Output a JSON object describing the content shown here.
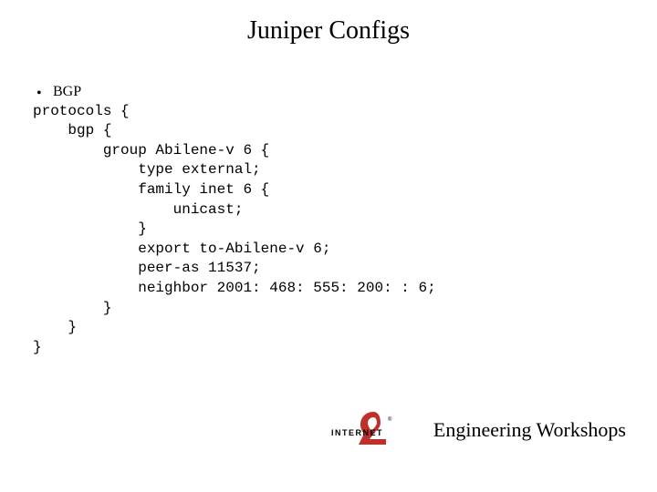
{
  "title": "Juniper Configs",
  "bullet": "BGP",
  "code": "protocols {\n    bgp {\n        group Abilene-v 6 {\n            type external;\n            family inet 6 {\n                unicast;\n            }\n            export to-Abilene-v 6;\n            peer-as 11537;\n            neighbor 2001: 468: 555: 200: : 6;\n        }\n    }\n}",
  "footer_text": "Engineering Workshops",
  "logo_name": "INTERNET2"
}
